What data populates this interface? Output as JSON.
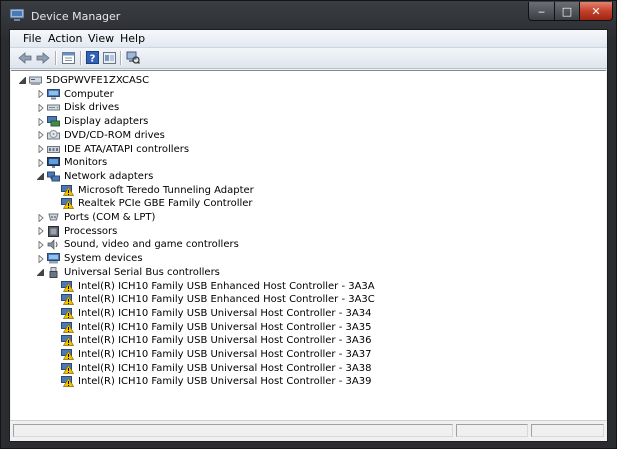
{
  "window": {
    "title": "Device Manager",
    "caption_min": "‒",
    "caption_max": "□",
    "caption_close": "✕"
  },
  "menu": {
    "items": [
      {
        "label": "File"
      },
      {
        "label": "Action"
      },
      {
        "label": "View"
      },
      {
        "label": "Help"
      }
    ]
  },
  "toolbar": {
    "buttons": [
      "back-icon",
      "forward-icon",
      "properties-icon",
      "help-icon",
      "show-hide-icon",
      "scan-hardware-icon"
    ]
  },
  "tree": {
    "root": "5DGPWVFE1ZXCASC",
    "categories": [
      {
        "label": "Computer",
        "icon": "computer-icon"
      },
      {
        "label": "Disk drives",
        "icon": "disk-drive-icon"
      },
      {
        "label": "Display adapters",
        "icon": "display-adapter-icon"
      },
      {
        "label": "DVD/CD-ROM drives",
        "icon": "dvd-drive-icon"
      },
      {
        "label": "IDE ATA/ATAPI controllers",
        "icon": "ide-controller-icon"
      },
      {
        "label": "Monitors",
        "icon": "monitor-icon"
      },
      {
        "label": "Network adapters",
        "icon": "network-adapter-icon",
        "children": [
          {
            "label": "Microsoft Teredo Tunneling Adapter",
            "warning": true
          },
          {
            "label": "Realtek PCIe GBE Family Controller",
            "warning": true
          }
        ]
      },
      {
        "label": "Ports (COM & LPT)",
        "icon": "port-icon"
      },
      {
        "label": "Processors",
        "icon": "processor-icon"
      },
      {
        "label": "Sound, video and game controllers",
        "icon": "sound-icon"
      },
      {
        "label": "System devices",
        "icon": "system-device-icon"
      },
      {
        "label": "Universal Serial Bus controllers",
        "icon": "usb-icon",
        "children": [
          {
            "label": "Intel(R) ICH10 Family USB Enhanced Host Controller - 3A3A",
            "warning": true
          },
          {
            "label": "Intel(R) ICH10 Family USB Enhanced Host Controller - 3A3C",
            "warning": true
          },
          {
            "label": "Intel(R) ICH10 Family USB Universal Host Controller - 3A34",
            "warning": true
          },
          {
            "label": "Intel(R) ICH10 Family USB Universal Host Controller - 3A35",
            "warning": true
          },
          {
            "label": "Intel(R) ICH10 Family USB Universal Host Controller - 3A36",
            "warning": true
          },
          {
            "label": "Intel(R) ICH10 Family USB Universal Host Controller - 3A37",
            "warning": true
          },
          {
            "label": "Intel(R) ICH10 Family USB Universal Host Controller - 3A38",
            "warning": true
          },
          {
            "label": "Intel(R) ICH10 Family USB Universal Host Controller - 3A39",
            "warning": true
          }
        ]
      }
    ]
  },
  "colors": {
    "title_text": "#e8e8e8",
    "close_button": "#c4412b",
    "warning": "#f2c200"
  }
}
